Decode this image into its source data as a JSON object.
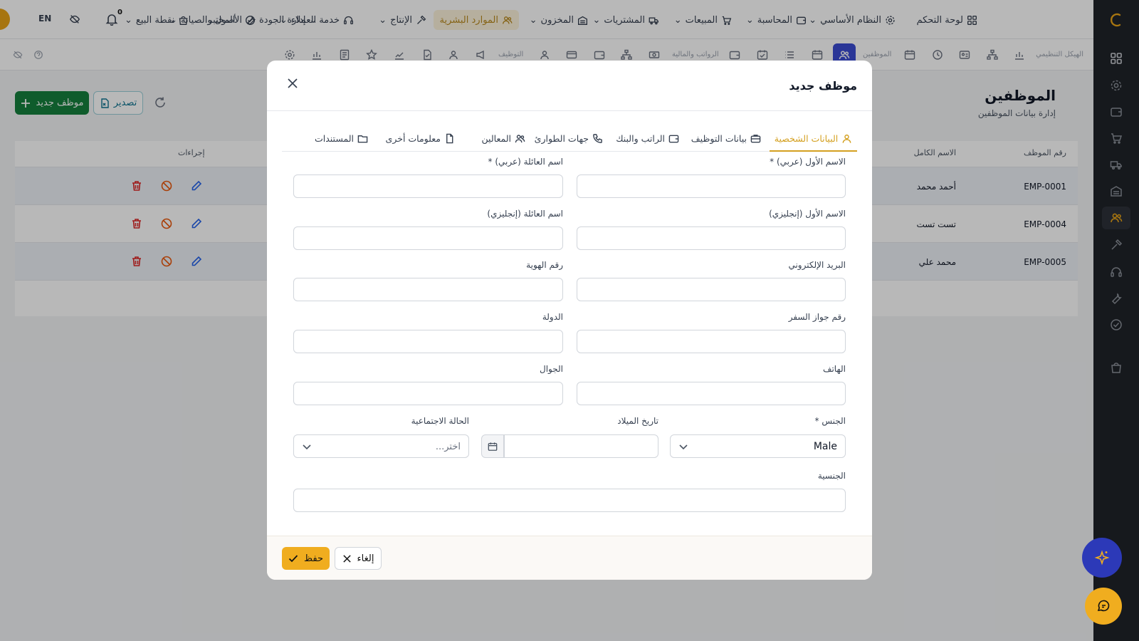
{
  "colors": {
    "primary": "#f0ad1f",
    "rail": "#1f2329",
    "success": "#15803d",
    "danger": "#dc2626",
    "info": "#2563eb"
  },
  "topnav": {
    "items": [
      {
        "label": "لوحة التحكم",
        "icon": "grid-icon"
      },
      {
        "label": "النظام الأساسي",
        "icon": "gear-icon"
      },
      {
        "label": "المحاسبة",
        "icon": "wallet-icon"
      },
      {
        "label": "المبيعات",
        "icon": "cart-icon"
      },
      {
        "label": "المشتريات",
        "icon": "truck-icon"
      },
      {
        "label": "المخزون",
        "icon": "warehouse-icon"
      },
      {
        "label": "الموارد البشرية",
        "icon": "users-icon"
      },
      {
        "label": "الإنتاج",
        "icon": "hammer-icon"
      },
      {
        "label": "خدمة العملاء",
        "icon": "headset-icon"
      },
      {
        "label": "الأصول والصيانة",
        "icon": "wrench-icon"
      },
      {
        "label": "إدارة الجودة",
        "icon": "check-circle-icon"
      },
      {
        "label": "المختبر",
        "icon": ""
      },
      {
        "label": "نقطة البيع",
        "icon": "shop-icon"
      }
    ],
    "notifications_count": "0",
    "language": "EN"
  },
  "subnav": {
    "labels": [
      "الهيكل التنظيمي",
      "الموظفين",
      "الرواتب والمالية",
      "التوظيف"
    ]
  },
  "page": {
    "title": "الموظفين",
    "subtitle": "إدارة بيانات الموظفين",
    "new_button": "موظف جديد",
    "export_button": "تصدير"
  },
  "table": {
    "headers": {
      "id": "رقم الموظف",
      "name": "الاسم الكامل",
      "actions": "إجراءات"
    },
    "rows": [
      {
        "id": "EMP-0001",
        "name": "أحمد محمد"
      },
      {
        "id": "EMP-0004",
        "name": "تست تست"
      },
      {
        "id": "EMP-0005",
        "name": "محمد علي"
      }
    ]
  },
  "modal": {
    "title": "موظف جديد",
    "tabs": [
      {
        "label": "البيانات الشخصية",
        "icon": "user-icon"
      },
      {
        "label": "بيانات التوظيف",
        "icon": "briefcase-icon"
      },
      {
        "label": "الراتب والبنك",
        "icon": "wallet-icon"
      },
      {
        "label": "جهات الطوارئ",
        "icon": "phone-icon"
      },
      {
        "label": "المعالين",
        "icon": "users-icon"
      },
      {
        "label": "معلومات أخرى",
        "icon": "file-icon"
      },
      {
        "label": "المستندات",
        "icon": "folder-icon"
      }
    ],
    "fields": {
      "first_name_ar": {
        "label": "الاسم الأول (عربي) *",
        "value": ""
      },
      "family_name_ar": {
        "label": "اسم العائلة (عربي) *",
        "value": ""
      },
      "first_name_en": {
        "label": "الاسم الأول (إنجليزي)",
        "value": ""
      },
      "family_name_en": {
        "label": "اسم العائلة (إنجليزي)",
        "value": ""
      },
      "email": {
        "label": "البريد الإلكتروني",
        "value": ""
      },
      "national_id": {
        "label": "رقم الهوية",
        "value": ""
      },
      "passport": {
        "label": "رقم جواز السفر",
        "value": ""
      },
      "country": {
        "label": "الدولة",
        "value": ""
      },
      "phone": {
        "label": "الهاتف",
        "value": ""
      },
      "mobile": {
        "label": "الجوال",
        "value": ""
      },
      "gender": {
        "label": "الجنس *",
        "value": "Male"
      },
      "birth_date": {
        "label": "تاريخ الميلاد",
        "value": ""
      },
      "marital_status": {
        "label": "الحالة الاجتماعية",
        "placeholder": "اختر..."
      },
      "nationality": {
        "label": "الجنسية",
        "value": ""
      }
    },
    "save_button": "حفظ",
    "cancel_button": "إلغاء"
  }
}
